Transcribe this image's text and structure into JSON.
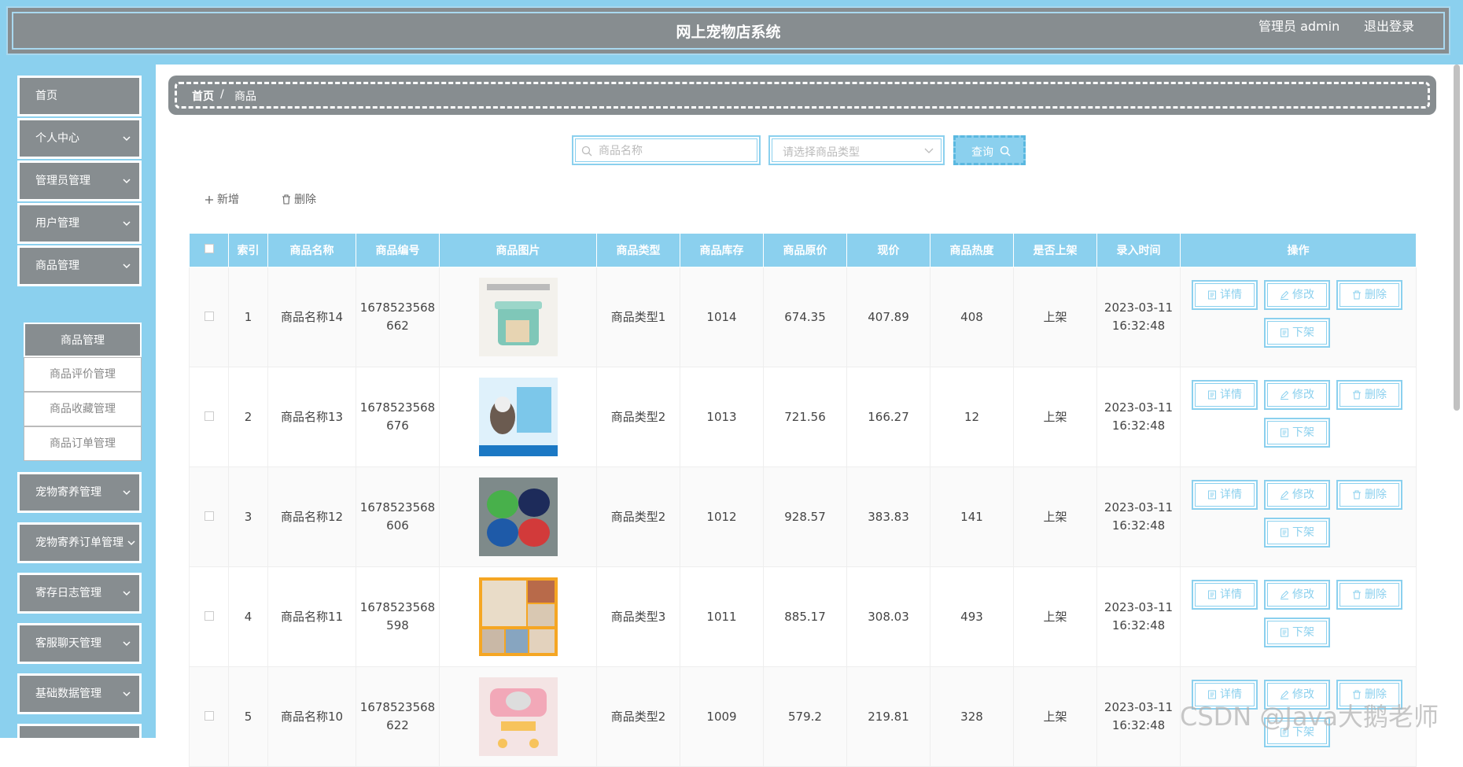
{
  "header": {
    "title": "网上宠物店系统",
    "user": "管理员 admin",
    "logout": "退出登录"
  },
  "sidebar": {
    "items": [
      {
        "label": "首页"
      },
      {
        "label": "个人中心"
      },
      {
        "label": "管理员管理"
      },
      {
        "label": "用户管理"
      },
      {
        "label": "商品管理"
      },
      {
        "label": "宠物寄养管理"
      },
      {
        "label": "宠物寄养订单管理"
      },
      {
        "label": "寄存日志管理"
      },
      {
        "label": "客服聊天管理"
      },
      {
        "label": "基础数据管理"
      }
    ],
    "submenu": [
      {
        "label": "商品管理"
      },
      {
        "label": "商品评价管理"
      },
      {
        "label": "商品收藏管理"
      },
      {
        "label": "商品订单管理"
      }
    ]
  },
  "breadcrumb": {
    "home": "首页",
    "sep": "/",
    "current": "商品"
  },
  "search": {
    "name_placeholder": "商品名称",
    "type_placeholder": "请选择商品类型",
    "query_label": "查询"
  },
  "toolbar": {
    "add_label": "新增",
    "delete_label": "删除"
  },
  "table": {
    "headers": [
      "索引",
      "商品名称",
      "商品编号",
      "商品图片",
      "商品类型",
      "商品库存",
      "商品原价",
      "现价",
      "商品热度",
      "是否上架",
      "录入时间",
      "操作"
    ],
    "rows": [
      {
        "index": "1",
        "name": "商品名称14",
        "code_a": "1678523568",
        "code_b": "662",
        "type": "商品类型1",
        "stock": "1014",
        "orig": "674.35",
        "price": "407.89",
        "heat": "408",
        "status": "上架",
        "date": "2023-03-11",
        "time": "16:32:48"
      },
      {
        "index": "2",
        "name": "商品名称13",
        "code_a": "1678523568",
        "code_b": "676",
        "type": "商品类型2",
        "stock": "1013",
        "orig": "721.56",
        "price": "166.27",
        "heat": "12",
        "status": "上架",
        "date": "2023-03-11",
        "time": "16:32:48"
      },
      {
        "index": "3",
        "name": "商品名称12",
        "code_a": "1678523568",
        "code_b": "606",
        "type": "商品类型2",
        "stock": "1012",
        "orig": "928.57",
        "price": "383.83",
        "heat": "141",
        "status": "上架",
        "date": "2023-03-11",
        "time": "16:32:48"
      },
      {
        "index": "4",
        "name": "商品名称11",
        "code_a": "1678523568",
        "code_b": "598",
        "type": "商品类型3",
        "stock": "1011",
        "orig": "885.17",
        "price": "308.03",
        "heat": "493",
        "status": "上架",
        "date": "2023-03-11",
        "time": "16:32:48"
      },
      {
        "index": "5",
        "name": "商品名称10",
        "code_a": "1678523568",
        "code_b": "622",
        "type": "商品类型2",
        "stock": "1009",
        "orig": "579.2",
        "price": "219.81",
        "heat": "328",
        "status": "上架",
        "date": "2023-03-11",
        "time": "16:32:48"
      }
    ],
    "ops": {
      "detail": "详情",
      "edit": "修改",
      "delete": "删除",
      "offshelf": "下架"
    }
  },
  "watermark": "CSDN @Java大鹅老师",
  "colors": {
    "accent": "#8bd0ee",
    "panel": "#878d90"
  }
}
